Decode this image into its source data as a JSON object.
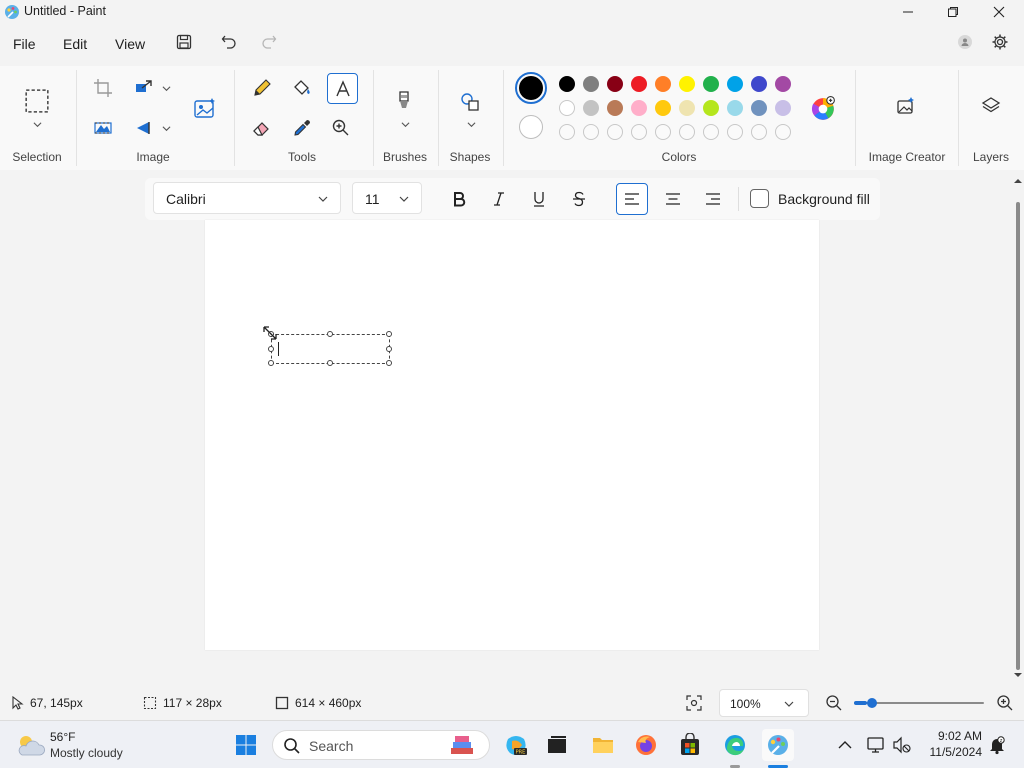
{
  "window": {
    "title": "Untitled - Paint"
  },
  "menu": {
    "file": "File",
    "edit": "Edit",
    "view": "View"
  },
  "ribbon": {
    "groups": {
      "selection": "Selection",
      "image": "Image",
      "tools": "Tools",
      "brushes": "Brushes",
      "shapes": "Shapes",
      "colors": "Colors",
      "image_creator": "Image Creator",
      "layers": "Layers"
    },
    "palette_row1": [
      "#000000",
      "#7f7f7f",
      "#880015",
      "#ed1c24",
      "#ff7f27",
      "#fff200",
      "#22b14c",
      "#00a2e8",
      "#3f48cc",
      "#a349a4"
    ],
    "palette_row2": [
      "#ffffff",
      "#c3c3c3",
      "#b97a57",
      "#ffaec9",
      "#ffc90e",
      "#efe4b0",
      "#b5e61d",
      "#99d9ea",
      "#7092be",
      "#c8bfe7"
    ],
    "primary_color": "#000000",
    "secondary_color": "#ffffff"
  },
  "textbar": {
    "font": "Calibri",
    "size": "11",
    "background_fill": "Background fill"
  },
  "status": {
    "cursor": "67, 145px",
    "selection": "117 × 28px",
    "canvas_size": "614 × 460px",
    "zoom": "100%",
    "zoom_level": 0.1
  },
  "taskbar": {
    "weather_temp": "56°F",
    "weather_desc": "Mostly cloudy",
    "search_placeholder": "Search",
    "time": "9:02 AM",
    "date": "11/5/2024"
  }
}
